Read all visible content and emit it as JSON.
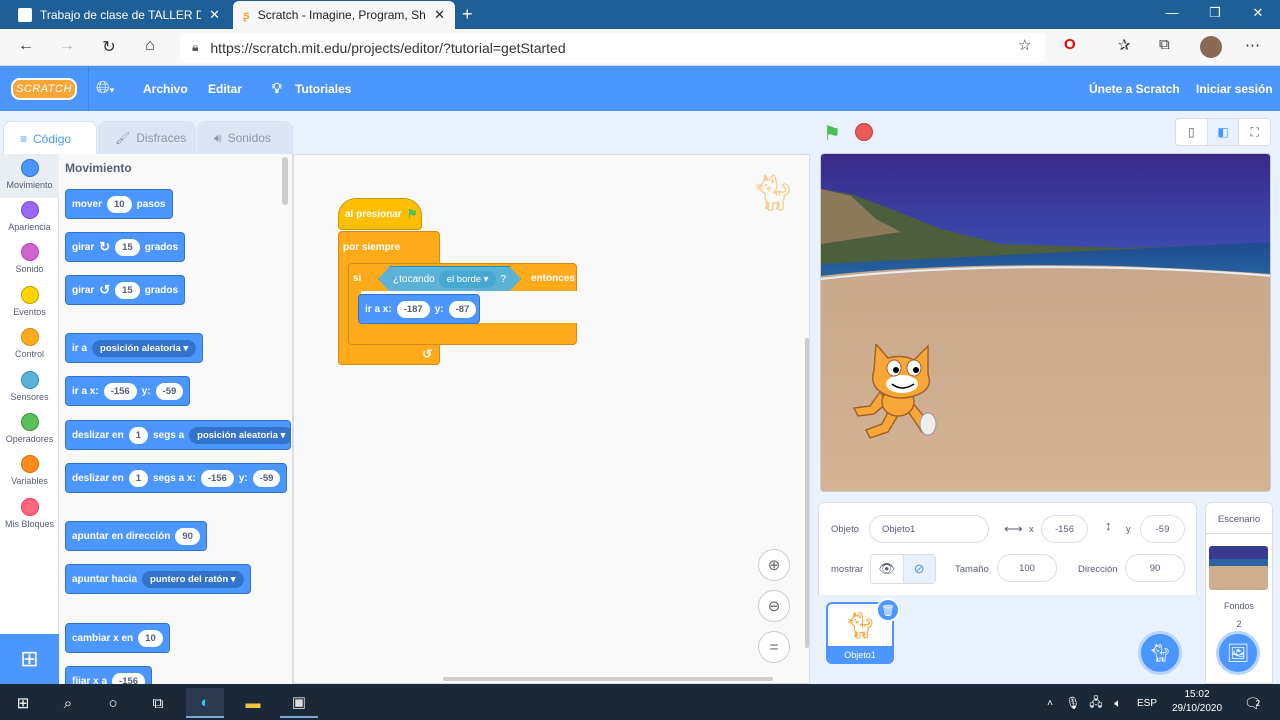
{
  "browser": {
    "tabs": [
      {
        "title": "Trabajo de clase de TALLER DE C",
        "icon": "classroom-icon"
      },
      {
        "title": "Scratch - Imagine, Program, Shar",
        "icon": "scratch-icon"
      }
    ],
    "url": "https://scratch.mit.edu/projects/editor/?tutorial=getStarted"
  },
  "menu": {
    "logo": "SCRATCH",
    "file": "Archivo",
    "edit": "Editar",
    "tutorials": "Tutoriales",
    "join": "Únete a Scratch",
    "signin": "Iniciar sesión"
  },
  "editor_tabs": {
    "code": "Código",
    "costumes": "Disfraces",
    "sounds": "Sonidos"
  },
  "categories": [
    {
      "label": "Movimiento",
      "color": "#4c97ff"
    },
    {
      "label": "Apariencia",
      "color": "#9966ff"
    },
    {
      "label": "Sonido",
      "color": "#cf63cf"
    },
    {
      "label": "Eventos",
      "color": "#ffd500"
    },
    {
      "label": "Control",
      "color": "#ffab19"
    },
    {
      "label": "Sensores",
      "color": "#5cb1d6"
    },
    {
      "label": "Operadores",
      "color": "#59c059"
    },
    {
      "label": "Variables",
      "color": "#ff8c1a"
    },
    {
      "label": "Mis Bloques",
      "color": "#ff6680"
    }
  ],
  "palette": {
    "heading": "Movimiento",
    "move": {
      "a": "mover",
      "v": "10",
      "b": "pasos"
    },
    "turn_right": {
      "a": "girar",
      "v": "15",
      "b": "grados"
    },
    "turn_left": {
      "a": "girar",
      "v": "15",
      "b": "grados"
    },
    "goto": {
      "a": "ir a",
      "d": "posición aleatoria"
    },
    "gotoxy": {
      "a": "ir a x:",
      "x": "-156",
      "b": "y:",
      "y": "-59"
    },
    "glide": {
      "a": "deslizar en",
      "v": "1",
      "b": "segs a",
      "d": "posición aleatoria"
    },
    "glidexy": {
      "a": "deslizar en",
      "v": "1",
      "b": "segs a x:",
      "x": "-156",
      "c": "y:",
      "y": "-59"
    },
    "point": {
      "a": "apuntar en dirección",
      "v": "90"
    },
    "pointto": {
      "a": "apuntar hacia",
      "d": "puntero del ratón"
    },
    "changex": {
      "a": "cambiar x en",
      "v": "10"
    },
    "setx": {
      "a": "fijar x a",
      "v": "-156"
    }
  },
  "script": {
    "hat": "al presionar",
    "forever": "por siempre",
    "if": "si",
    "touching": "¿tocando",
    "edge": "el borde",
    "q": "?",
    "then": "entonces",
    "goto": "ir a x:",
    "x": "-187",
    "ylbl": "y:",
    "y": "-87"
  },
  "sprite_info": {
    "sprite_lbl": "Objeto",
    "sprite": "Objeto1",
    "x_lbl": "x",
    "x": "-156",
    "y_lbl": "y",
    "y": "-59",
    "show_lbl": "mostrar",
    "size_lbl": "Tamaño",
    "size": "100",
    "dir_lbl": "Dirección",
    "dir": "90",
    "thumb": "Objeto1"
  },
  "stage_pane": {
    "title": "Escenario",
    "backdrops": "Fondos",
    "count": "2"
  },
  "taskbar": {
    "lang": "ESP",
    "time": "15:02",
    "date": "29/10/2020",
    "notif": "2"
  }
}
